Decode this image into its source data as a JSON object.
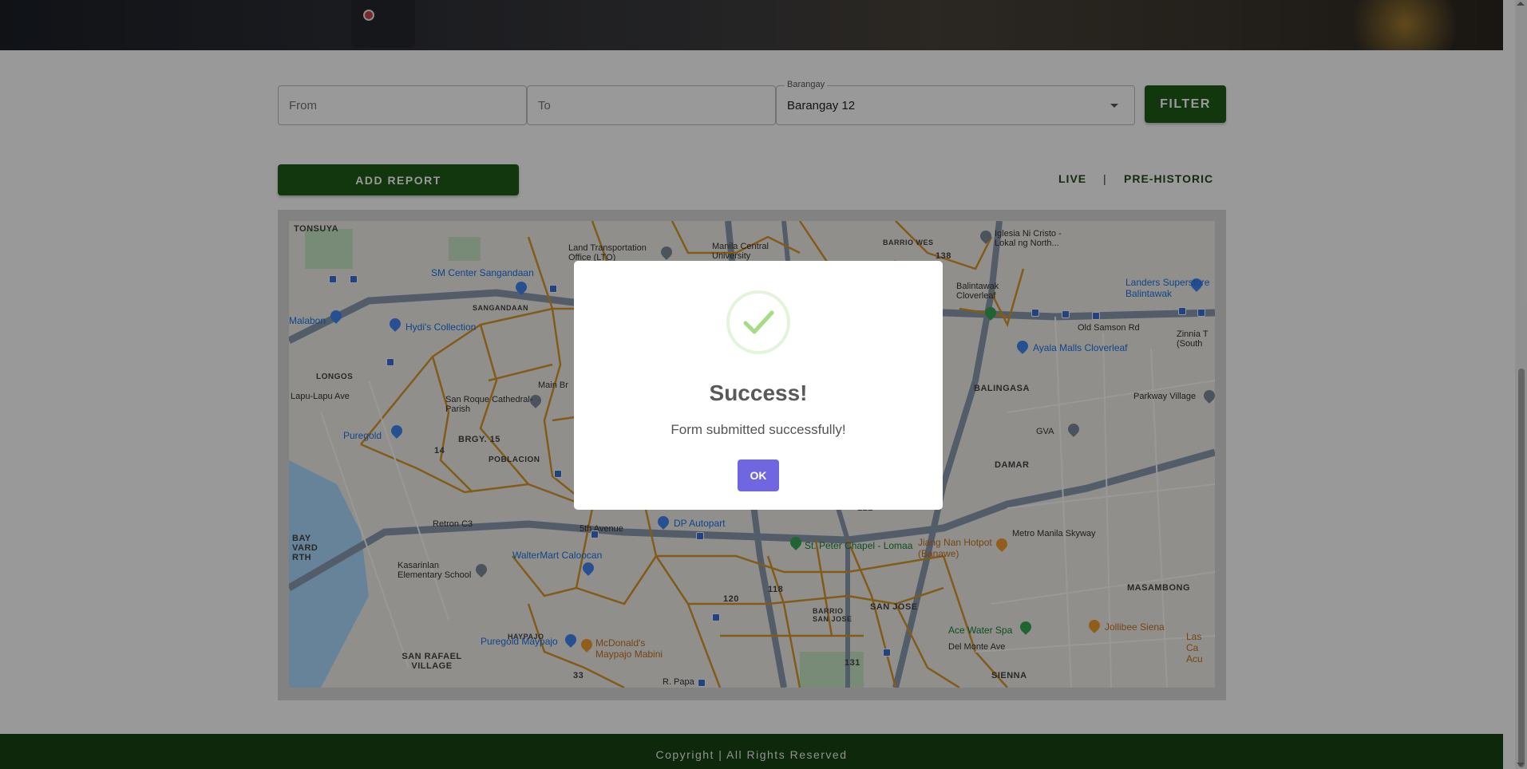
{
  "filters": {
    "from_placeholder": "From",
    "to_placeholder": "To",
    "barangay_label": "Barangay",
    "barangay_value": "Barangay 12",
    "filter_button": "FILTER"
  },
  "actions": {
    "add_report": "ADD REPORT",
    "mode_live": "LIVE",
    "mode_separator": "|",
    "mode_prehistoric": "PRE-HISTORIC"
  },
  "map": {
    "areas": [
      "TONSUYA",
      "SANGANDAAN",
      "LONGOS",
      "BRGY. 15",
      "POBLACION",
      "14",
      "138",
      "BARRIO WES",
      "BALINGASA",
      "DAMAR",
      "SAN JOSE",
      "MASAMBONG",
      "SIENNA",
      "SAN RAFAEL VILLAGE",
      "HAYPAJO",
      "BAY VARD RTH",
      "BARRIO SAN JOSE",
      "118",
      "120",
      "122",
      "131",
      "33"
    ],
    "pois": [
      "SM Center Sangandaan",
      "Land Transportation Office (LTO)",
      "Manila Central University",
      "Iglesia Ni Cristo - Lokal ng North...",
      "Landers Superstore Balintawak",
      "Malabon",
      "Hydi's Collection",
      "Balintawak Cloverleaf",
      "Ayala Malls Cloverleaf",
      "Zinnia T (South",
      "San Roque Cathedral-Parish",
      "Parkway Village",
      "Puregold",
      "GVA",
      "Retron C3",
      "DP Autopart",
      "Jiang Nan Hotpot (Banawe)",
      "St. Peter Chapel - Lomaa",
      "WalterMart Caloocan",
      "Kasarinlan Elementary School",
      "Puregold Maypajo",
      "McDonald's Maypajo Mabini",
      "Ace Water Spa",
      "Jollibee Siena",
      "Las Ca Acu",
      "Del Monte Ave",
      "Old Samson Rd",
      "Metro Manila Skyway",
      "Main Br",
      "Lapu-Lapu Ave",
      "R. Papa",
      "5th Avenue"
    ]
  },
  "footer": {
    "text": "Copyright | All Rights Reserved"
  },
  "dialog": {
    "title": "Success!",
    "message": "Form submitted successfully!",
    "ok_button": "OK",
    "icon": "success-check-icon"
  },
  "colors": {
    "primary_green": "#1e5b16",
    "footer_green": "#174312",
    "ok_button": "#7066e0",
    "success_check": "#a5dc86"
  }
}
